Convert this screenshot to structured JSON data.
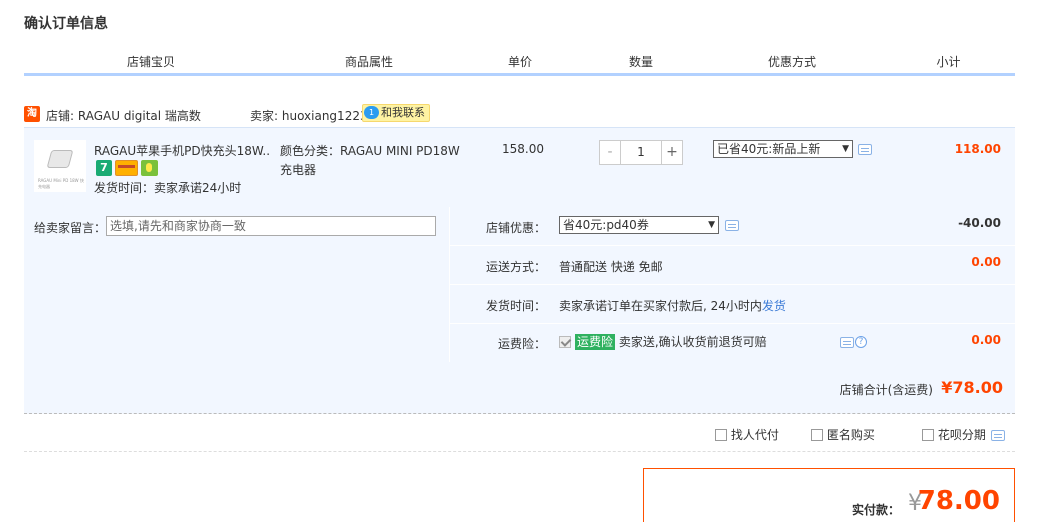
{
  "page": {
    "title": "确认订单信息"
  },
  "columns": [
    "店铺宝贝",
    "商品属性",
    "单价",
    "数量",
    "优惠方式",
    "小计"
  ],
  "shop": {
    "logo_text": "淘",
    "label": "店铺: RAGAU digital 瑞高数",
    "seller": "卖家: huoxiang1223",
    "contact_icon_text": "1",
    "contact": "和我联系"
  },
  "item": {
    "thumb_text": "RAGAU Mini PD 18W 快充电器",
    "title": "RAGAU苹果手机PD快充头18W...",
    "badge_seven": "7",
    "ship_time": "发货时间：卖家承诺24小时",
    "attr": "颜色分类：RAGAU MINI PD18W 充电器",
    "unit_price": "158.00",
    "qty_minus": "-",
    "qty": "1",
    "qty_plus": "+",
    "discount_selected": "已省40元:新品上新",
    "subtotal": "118.00"
  },
  "order": {
    "message_label": "给卖家留言：",
    "message_placeholder": "选填,请先和商家协商一致",
    "shop_discount_label": "店铺优惠：",
    "shop_discount_selected": "省40元:pd40券",
    "shop_discount_amount": "-40.00",
    "shipping_label": "运送方式：",
    "shipping_value": "普通配送 快递 免邮",
    "shipping_amount": "0.00",
    "delivery_label": "发货时间：",
    "delivery_value": "卖家承诺订单在买家付款后, 24小时内",
    "delivery_link": "发货",
    "insurance_label": "运费险：",
    "insurance_tag": "运费险",
    "insurance_value": "卖家送,确认收货前退货可赔",
    "insurance_amount": "0.00",
    "help_icon_text": "?"
  },
  "shop_total": {
    "label": "店铺合计(含运费)",
    "value": "¥78.00"
  },
  "options": {
    "proxy_pay": "找人代付",
    "anonymous": "匿名购买",
    "huabei": "花呗分期"
  },
  "payment": {
    "label": "实付款：",
    "currency": "¥",
    "value": "78.00"
  },
  "colors": {
    "accent": "#ff4400",
    "header_line": "#b2d1ff",
    "block_bg": "#f2f7ff",
    "link": "#3c7bd6"
  }
}
